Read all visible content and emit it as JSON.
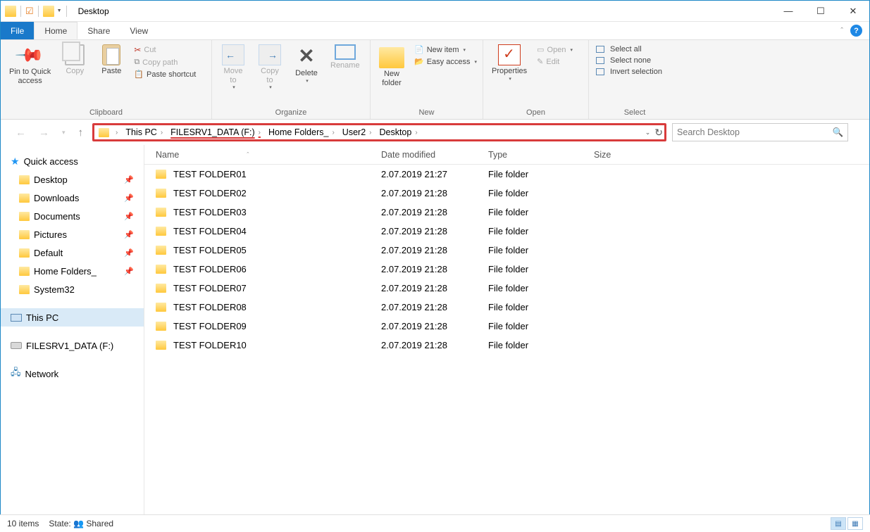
{
  "title": "Desktop",
  "menubar": {
    "file": "File",
    "tabs": [
      "Home",
      "Share",
      "View"
    ],
    "active": 0
  },
  "ribbon": {
    "clipboard": {
      "label": "Clipboard",
      "pin": "Pin to Quick\naccess",
      "copy": "Copy",
      "paste": "Paste",
      "cut": "Cut",
      "copy_path": "Copy path",
      "paste_shortcut": "Paste shortcut"
    },
    "organize": {
      "label": "Organize",
      "move": "Move\nto",
      "copy": "Copy\nto",
      "delete": "Delete",
      "rename": "Rename"
    },
    "new": {
      "label": "New",
      "new_folder": "New\nfolder",
      "new_item": "New item",
      "easy_access": "Easy access"
    },
    "open": {
      "label": "Open",
      "properties": "Properties",
      "open": "Open",
      "edit": "Edit"
    },
    "select": {
      "label": "Select",
      "all": "Select all",
      "none": "Select none",
      "invert": "Invert selection"
    }
  },
  "breadcrumb": [
    "This PC",
    "FILESRV1_DATA (F:)",
    "Home Folders_",
    "User2",
    "Desktop"
  ],
  "search_placeholder": "Search Desktop",
  "columns": {
    "name": "Name",
    "date": "Date modified",
    "type": "Type",
    "size": "Size"
  },
  "sidebar": {
    "quick_access": "Quick access",
    "pinned": [
      {
        "label": "Desktop",
        "pin": true
      },
      {
        "label": "Downloads",
        "pin": true
      },
      {
        "label": "Documents",
        "pin": true
      },
      {
        "label": "Pictures",
        "pin": true
      },
      {
        "label": "Default",
        "pin": true
      },
      {
        "label": "Home Folders_",
        "pin": true
      },
      {
        "label": "System32",
        "pin": false
      }
    ],
    "this_pc": "This PC",
    "drive": "FILESRV1_DATA (F:)",
    "network": "Network"
  },
  "files": [
    {
      "name": "TEST FOLDER01",
      "date": "2.07.2019 21:27",
      "type": "File folder"
    },
    {
      "name": "TEST FOLDER02",
      "date": "2.07.2019 21:28",
      "type": "File folder"
    },
    {
      "name": "TEST FOLDER03",
      "date": "2.07.2019 21:28",
      "type": "File folder"
    },
    {
      "name": "TEST FOLDER04",
      "date": "2.07.2019 21:28",
      "type": "File folder"
    },
    {
      "name": "TEST FOLDER05",
      "date": "2.07.2019 21:28",
      "type": "File folder"
    },
    {
      "name": "TEST FOLDER06",
      "date": "2.07.2019 21:28",
      "type": "File folder"
    },
    {
      "name": "TEST FOLDER07",
      "date": "2.07.2019 21:28",
      "type": "File folder"
    },
    {
      "name": "TEST FOLDER08",
      "date": "2.07.2019 21:28",
      "type": "File folder"
    },
    {
      "name": "TEST FOLDER09",
      "date": "2.07.2019 21:28",
      "type": "File folder"
    },
    {
      "name": "TEST FOLDER10",
      "date": "2.07.2019 21:28",
      "type": "File folder"
    }
  ],
  "status": {
    "count": "10 items",
    "state_label": "State:",
    "state_value": "Shared"
  }
}
